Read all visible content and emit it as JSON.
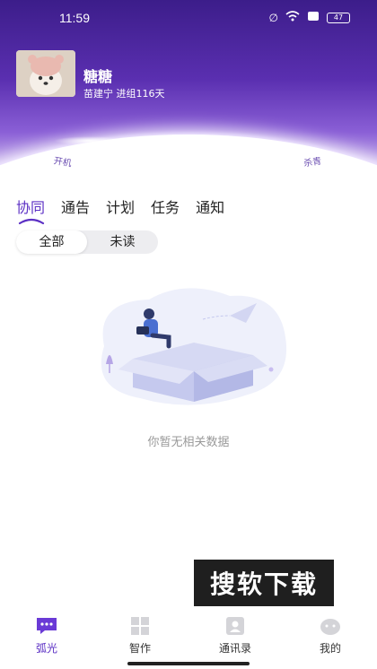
{
  "status_bar": {
    "time": "11:59",
    "battery": "47"
  },
  "profile": {
    "name": "糖糖",
    "subtitle": "苗建宁 进组116天"
  },
  "arc": {
    "left_label": "开机",
    "right_label": "杀青"
  },
  "tabs": [
    {
      "label": "协同",
      "active": true
    },
    {
      "label": "通告",
      "active": false
    },
    {
      "label": "计划",
      "active": false
    },
    {
      "label": "任务",
      "active": false
    },
    {
      "label": "通知",
      "active": false
    }
  ],
  "filter": {
    "options": [
      {
        "label": "全部",
        "active": true
      },
      {
        "label": "未读",
        "active": false
      }
    ]
  },
  "empty_state": {
    "message": "你暂无相关数据"
  },
  "watermark": {
    "text": "搜软下载"
  },
  "bottom_nav": {
    "items": [
      {
        "label": "弧光",
        "icon": "chat-bubble-icon",
        "active": true
      },
      {
        "label": "智作",
        "icon": "grid-icon",
        "active": false
      },
      {
        "label": "通讯录",
        "icon": "contacts-icon",
        "active": false
      },
      {
        "label": "我的",
        "icon": "profile-icon",
        "active": false
      }
    ]
  },
  "colors": {
    "accent": "#5b2fc4",
    "header_top": "#3c1d8a",
    "muted_text": "#999999"
  }
}
